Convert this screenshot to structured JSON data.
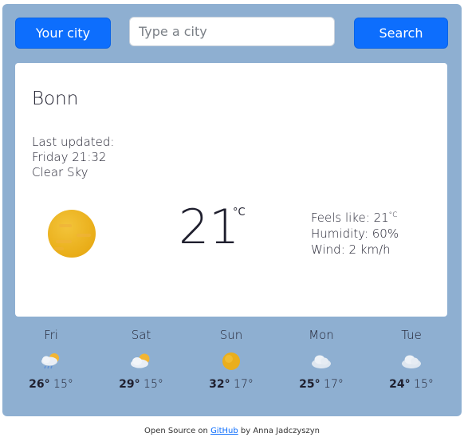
{
  "header": {
    "your_city_label": "Your city",
    "search_placeholder": "Type a city",
    "search_value": "",
    "search_label": "Search"
  },
  "current": {
    "city": "Bonn",
    "updated_label": "Last updated:",
    "updated_time": "Friday 21:32",
    "condition": "Clear Sky",
    "icon": "sun-icon",
    "temperature": "21",
    "unit": "°C",
    "feels_like_label": "Feels like: ",
    "feels_like_value": "21",
    "feels_like_unit": "°C",
    "humidity": "Humidity: 60%",
    "wind": "Wind: 2 km/h"
  },
  "forecast": [
    {
      "day": "Fri",
      "icon": "cloud-rain-sun-icon",
      "hi": "26°",
      "lo": "15°"
    },
    {
      "day": "Sat",
      "icon": "cloud-sun-icon",
      "hi": "29°",
      "lo": "15°"
    },
    {
      "day": "Sun",
      "icon": "sun-icon",
      "hi": "32°",
      "lo": "17°"
    },
    {
      "day": "Mon",
      "icon": "cloud-icon",
      "hi": "25°",
      "lo": "17°"
    },
    {
      "day": "Tue",
      "icon": "cloud-icon",
      "hi": "24°",
      "lo": "15°"
    }
  ],
  "footer": {
    "prefix": "Open Source on ",
    "link": "GitHub",
    "suffix": " by Anna Jadczyszyn"
  },
  "colors": {
    "background": "#8eafd1",
    "accent": "#0d6efd",
    "sun": "#e9ad18"
  }
}
